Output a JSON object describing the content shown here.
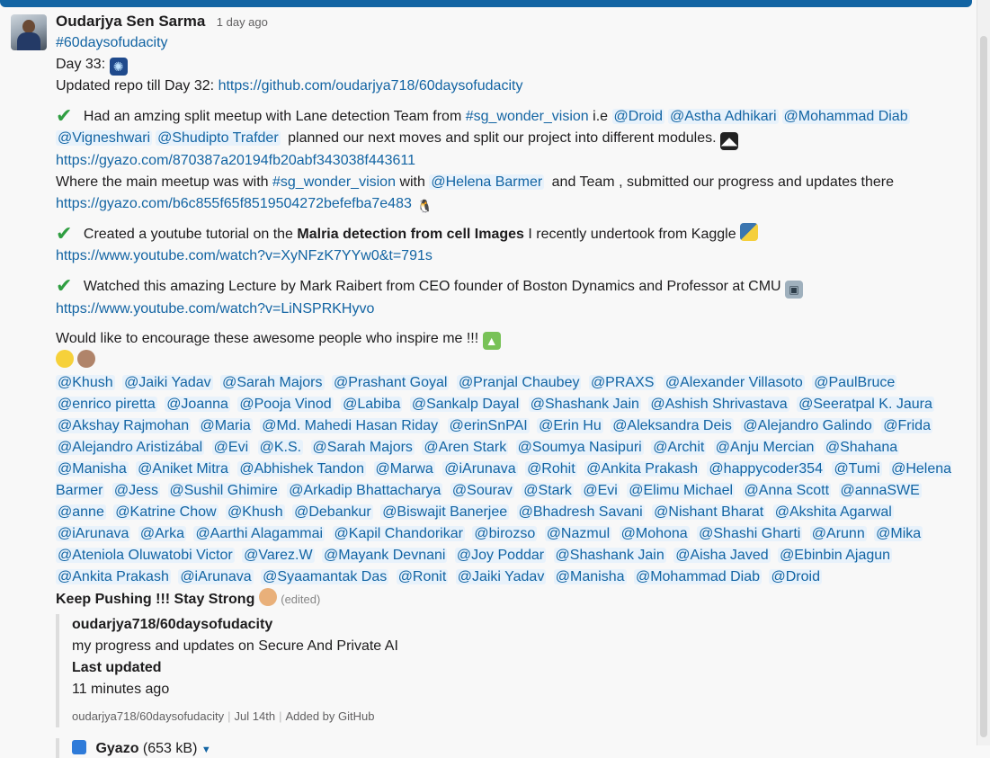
{
  "message": {
    "author": "Oudarjya Sen Sarma",
    "timestamp": "1 day ago",
    "hashtag": "#60daysofudacity",
    "day_label": "Day 33:",
    "repo_prefix": "Updated repo till Day 32:",
    "repo_url": "https://github.com/oudarjya718/60daysofudacity",
    "p1_a": "Had an amzing split meetup with Lane detection Team from",
    "p1_channel": "#sg_wonder_vision",
    "p1_b": "i.e",
    "p1_m1": "@Droid",
    "p1_m2": "@Astha Adhikari",
    "p1_m3": "@Mohammad Diab",
    "p1_m4": "@Vigneshwari",
    "p1_m5": "@Shudipto Trafder",
    "p1_c": "planned our next moves and split our project into different modules.",
    "p1_link": "https://gyazo.com/870387a20194fb20abf343038f443611",
    "p2_a": "Where the main meetup was with",
    "p2_channel": "#sg_wonder_vision",
    "p2_b": "with",
    "p2_m1": "@Helena Barmer",
    "p2_c": "and Team , submitted our progress and updates there",
    "p2_link": "https://gyazo.com/b6c855f65f8519504272befefba7e483",
    "p3_a": "Created a youtube tutorial on the",
    "p3_bold": "Malria detection from cell Images",
    "p3_b": "I recently undertook from Kaggle",
    "p3_link": "https://www.youtube.com/watch?v=XyNFzK7YYw0&t=791s",
    "p4_a": "Watched this amazing Lecture by Mark Raibert from CEO founder of Boston Dynamics and Professor at CMU",
    "p4_link": "https://www.youtube.com/watch?v=LiNSPRKHyvo",
    "encourage": "Would like to encourage these awesome people who inspire me !!!",
    "mentions": [
      "@Khush",
      "@Jaiki Yadav",
      "@Sarah Majors",
      "@Prashant Goyal",
      "@Pranjal Chaubey",
      "@PRAXS",
      "@Alexander Villasoto",
      "@PaulBruce",
      "@enrico piretta",
      "@Joanna",
      "@Pooja Vinod",
      "@Labiba",
      "@Sankalp Dayal",
      "@Shashank Jain",
      "@Ashish Shrivastava",
      "@Seeratpal K. Jaura",
      "@Akshay Rajmohan",
      "@Maria",
      "@Md. Mahedi Hasan Riday",
      "@erinSnPAI",
      "@Erin Hu",
      "@Aleksandra Deis",
      "@Alejandro Galindo",
      "@Frida",
      "@Alejandro Aristizábal",
      "@Evi",
      "@K.S.",
      "@Sarah Majors",
      "@Aren Stark",
      "@Soumya Nasipuri",
      "@Archit",
      "@Anju Mercian",
      "@Shahana",
      "@Manisha",
      "@Aniket Mitra",
      "@Abhishek Tandon",
      "@Marwa",
      "@iArunava",
      "@Rohit",
      "@Ankita Prakash",
      "@happycoder354",
      "@Tumi",
      "@Helena Barmer",
      "@Jess",
      "@Sushil Ghimire",
      "@Arkadip Bhattacharya",
      "@Sourav",
      "@Stark",
      "@Evi",
      "@Elimu Michael",
      "@Anna Scott",
      "@annaSWE",
      "@anne",
      "@Katrine Chow",
      "@Khush",
      "@Debankur",
      "@Biswajit Banerjee",
      "@Bhadresh Savani",
      "@Nishant Bharat",
      "@Akshita Agarwal",
      "@iArunava",
      "@Arka",
      "@Aarthi Alagammai",
      "@Kapil Chandorikar",
      "@birozso",
      "@Nazmul",
      "@Mohona",
      "@Shashi Gharti",
      "@Arunn",
      "@Mika",
      "@Ateniola Oluwatobi Victor",
      "@Varez.W",
      "@Mayank Devnani",
      "@Joy Poddar",
      "@Shashank Jain",
      "@Aisha Javed",
      "@Ebinbin Ajagun",
      "@Ankita Prakash",
      "@iArunava",
      "@Syaamantak Das",
      "@Ronit",
      "@Jaiki Yadav",
      "@Manisha",
      "@Mohammad Diab",
      "@Droid"
    ],
    "closing": "Keep Pushing !!!  Stay Strong",
    "edited": "(edited)"
  },
  "attachment": {
    "title": "oudarjya718/60daysofudacity",
    "description": "my progress and updates on Secure And Private AI",
    "field_label": "Last updated",
    "field_value": "11 minutes ago",
    "footer_repo": "oudarjya718/60daysofudacity",
    "footer_date": "Jul 14th",
    "footer_source": "Added by GitHub"
  },
  "gyazo": {
    "name": "Gyazo",
    "size": "(653 kB)"
  },
  "colors": {
    "link": "#1264a3",
    "mention_bg": "#e8f2fb",
    "check": "#2f9e41",
    "top_bar": "#1264a3"
  },
  "icons": [
    "sparkle-emoji",
    "batman-emoji",
    "penguin-emoji",
    "python-emoji",
    "robot-emoji",
    "android-emoji",
    "smile-emoji",
    "clap-emoji",
    "flexed-biceps-emoji",
    "check-mark-icon",
    "gyazo-icon",
    "caret-down-icon"
  ]
}
